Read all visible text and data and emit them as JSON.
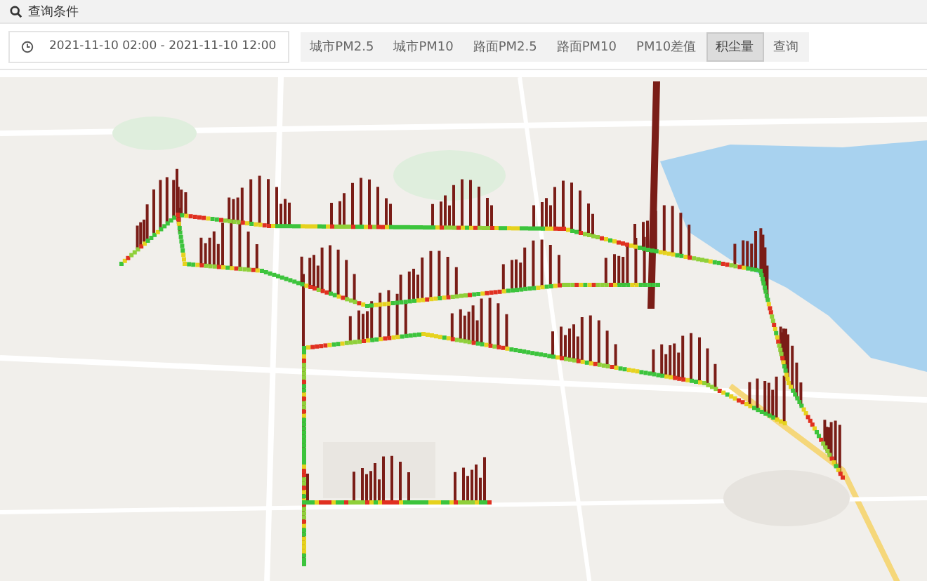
{
  "query_panel": {
    "title": "查询条件"
  },
  "time_range": {
    "value": "2021-11-10 02:00 - 2021-11-10 12:00"
  },
  "layers": [
    {
      "label": "城市PM2.5",
      "selected": false
    },
    {
      "label": "城市PM10",
      "selected": false
    },
    {
      "label": "路面PM2.5",
      "selected": false
    },
    {
      "label": "路面PM10",
      "selected": false
    },
    {
      "label": "PM10差值",
      "selected": false
    },
    {
      "label": "积尘量",
      "selected": true
    }
  ],
  "query_button": {
    "label": "查询"
  }
}
